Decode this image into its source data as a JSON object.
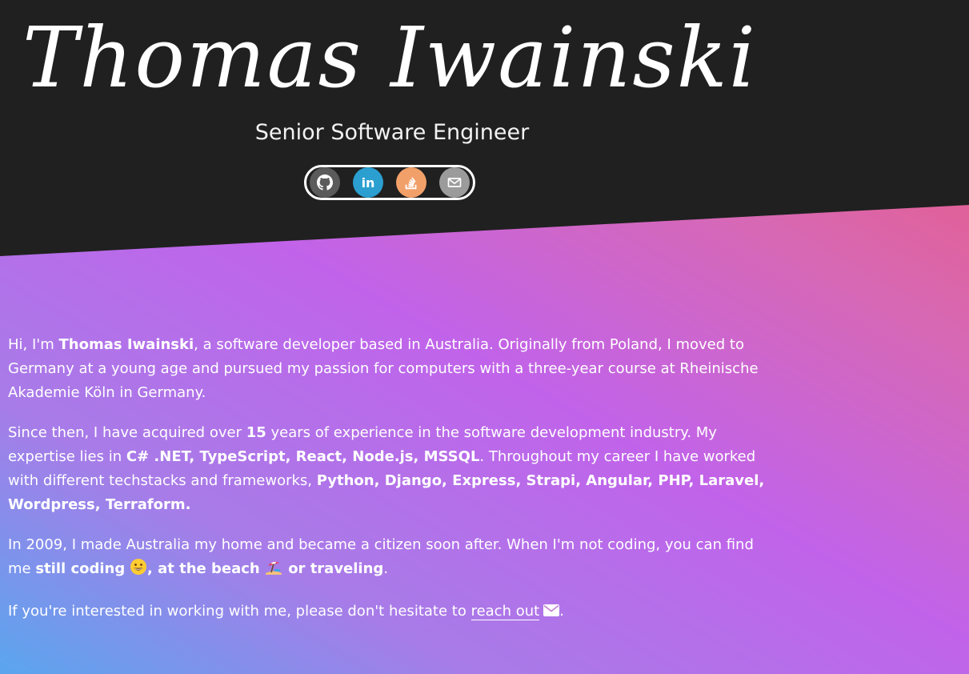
{
  "header": {
    "name": "Thomas Iwainski",
    "subtitle": "Senior Software Engineer"
  },
  "social": {
    "items": [
      {
        "name": "github",
        "icon": "github-icon",
        "color": "#5b5b5b"
      },
      {
        "name": "linkedin",
        "icon": "linkedin-icon",
        "label": "in",
        "color": "#2a9fd0"
      },
      {
        "name": "stackoverflow",
        "icon": "stackoverflow-icon",
        "color": "#f2a06a"
      },
      {
        "name": "email",
        "icon": "mail-icon",
        "color": "#9b9b9b"
      }
    ]
  },
  "colors": {
    "header_bg": "#202020",
    "gradient": [
      "#5aa6ee",
      "#a77ce8",
      "#c163ea",
      "#d768b4",
      "#f05772"
    ]
  },
  "intro": {
    "p1": {
      "t1": "Hi, I'm ",
      "b1": "Thomas Iwainski",
      "t2": ", a software developer based in Australia. Originally from Poland, I moved to Germany at a young age and pursued my passion for computers with a three-year course at Rheinische Akademie Köln in Germany."
    },
    "p2": {
      "t1": "Since then, I have acquired over ",
      "b1": "15",
      "t2": " years of experience in the software development industry. My expertise lies in ",
      "b2": "C# .NET, TypeScript, React, Node.js, MSSQL",
      "t3": ". Throughout my career I have worked with different techstacks and frameworks, ",
      "b3": "Python, Django, Express, Strapi, Angular, PHP, Laravel, Wordpress, Terraform."
    },
    "p3": {
      "t1": "In 2009, I made Australia my home and became a citizen soon after. When I'm not coding, you can find me ",
      "b1": "still coding",
      "emoji1": "grinning-face-icon",
      "b2": ", at the beach",
      "emoji2": "beach-umbrella-icon",
      "b3": "or traveling",
      "t2": "."
    },
    "p4": {
      "t1": "If you're interested in working with me, please don't hesitate to ",
      "link": "reach out",
      "icon": "envelope-icon",
      "t2": "."
    }
  }
}
